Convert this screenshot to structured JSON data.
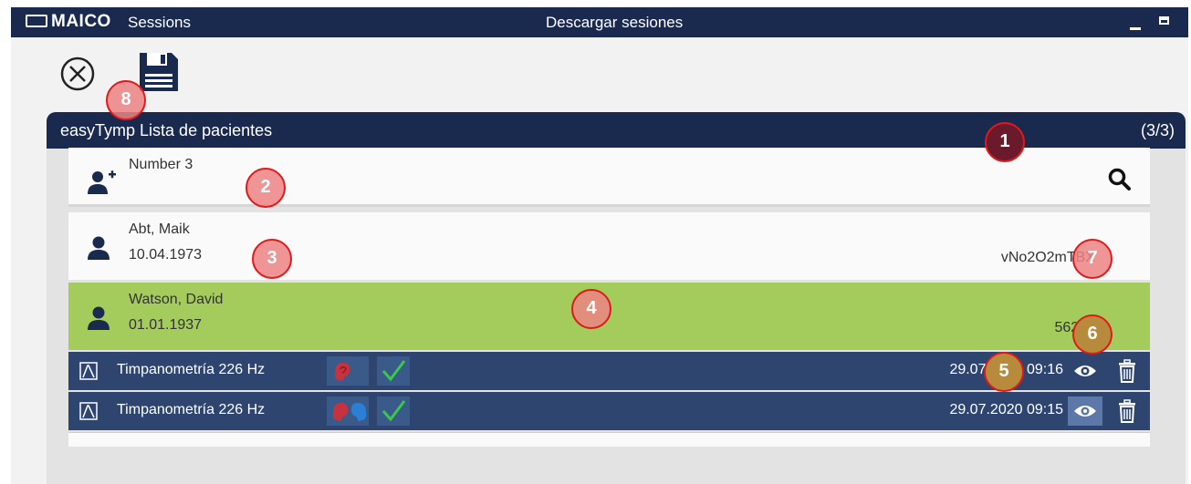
{
  "titlebar": {
    "logo": "MAICO",
    "app": "Sessions",
    "center": "Descargar sesiones"
  },
  "panel": {
    "title": "easyTymp Lista de pacientes",
    "count": "(3/3)"
  },
  "search": {
    "value": "Number 3"
  },
  "patients": [
    {
      "name": "Abt, Maik",
      "dob": "10.04.1973",
      "id": "vNo2O2mTBX"
    },
    {
      "name": "Watson, David",
      "dob": "01.01.1937",
      "id": "56201"
    }
  ],
  "sessions": [
    {
      "label": "Timpanometría 226 Hz",
      "datetime": "29.07.2020 09:16"
    },
    {
      "label": "Timpanometría 226 Hz",
      "datetime": "29.07.2020 09:15"
    }
  ],
  "callouts": [
    "1",
    "2",
    "3",
    "4",
    "5",
    "6",
    "7",
    "8"
  ],
  "colors": {
    "header": "#1a2a4f",
    "selected_row": "#a3cc5d",
    "session_row": "#2e4570",
    "callout_border": "#e01a1a"
  },
  "icons": [
    "close-icon",
    "save-icon",
    "add-user-icon",
    "search-icon",
    "user-icon",
    "tympanogram-icon",
    "ear-icon",
    "check-icon",
    "eye-icon",
    "trash-icon"
  ]
}
